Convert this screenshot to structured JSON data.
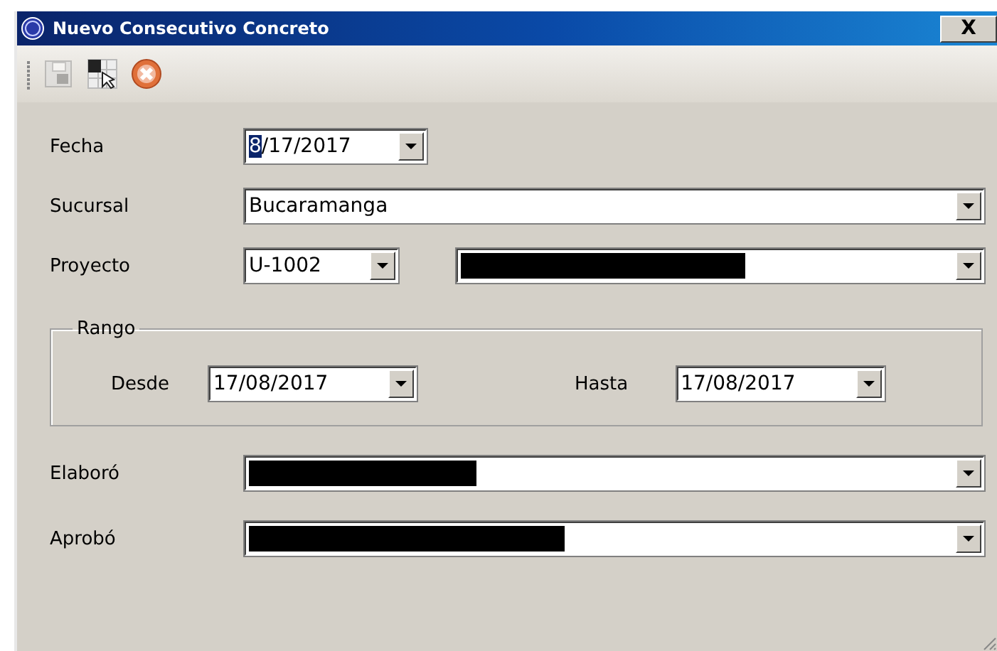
{
  "window": {
    "title": "Nuevo Consecutivo Concreto",
    "close_label": "X"
  },
  "toolbar": [
    {
      "kind": "save",
      "disabled": true
    },
    {
      "kind": "grid",
      "disabled": false
    },
    {
      "kind": "cancel",
      "disabled": false
    }
  ],
  "form": {
    "fecha": {
      "label": "Fecha",
      "selected_text": "8",
      "value": "/17/2017"
    },
    "sucursal": {
      "label": "Sucursal",
      "value": "Bucaramanga"
    },
    "proyecto": {
      "label": "Proyecto",
      "code": "U-1002",
      "name_redacted": true
    },
    "rango": {
      "title": "Rango",
      "desde": {
        "label": "Desde",
        "value": "17/08/2017"
      },
      "hasta": {
        "label": "Hasta",
        "value": "17/08/2017"
      }
    },
    "elaboro": {
      "label": "Elaboró",
      "redacted": true
    },
    "aprobo": {
      "label": "Aprobó",
      "redacted": true
    }
  }
}
